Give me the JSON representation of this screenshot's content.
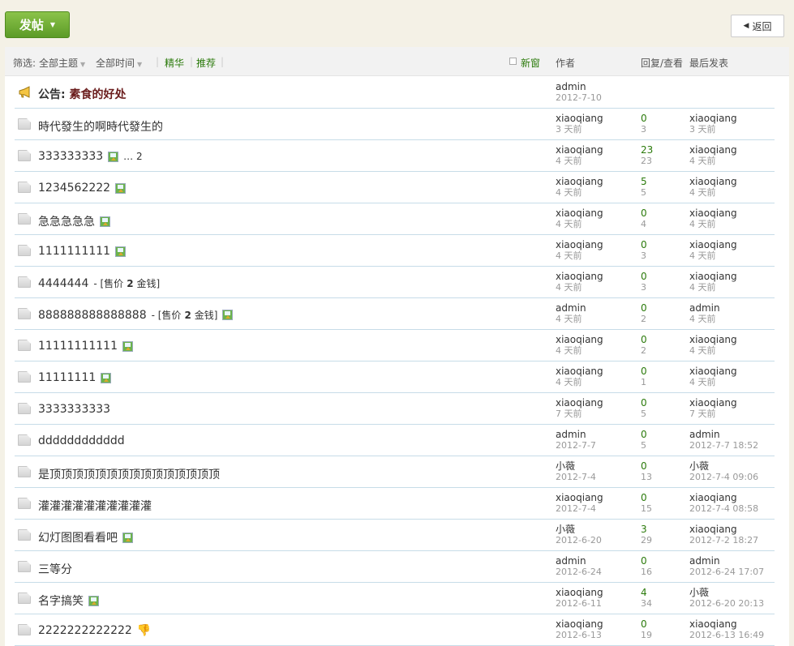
{
  "toolbar": {
    "post_label": "发帖",
    "back_label": "返回"
  },
  "filters": {
    "prefix": "筛选:",
    "all_topics": "全部主题",
    "all_time": "全部时间",
    "digest": "精华",
    "recommended": "推荐",
    "new_window": "新窗"
  },
  "columns": {
    "author": "作者",
    "replies_views": "回复/查看",
    "last_post": "最后发表"
  },
  "announcement": {
    "prefix": "公告: ",
    "title": "素食的好处",
    "author": "admin",
    "date": "2012-7-10"
  },
  "threads": [
    {
      "title": "時代發生的啊時代發生的",
      "extra": "",
      "has_image": false,
      "author": "xiaoqiang",
      "author_time": "3 天前",
      "replies": "0",
      "views": "3",
      "last_user": "xiaoqiang",
      "last_time": "3 天前"
    },
    {
      "title": "333333333",
      "extra": "… 2",
      "has_image": true,
      "author": "xiaoqiang",
      "author_time": "4 天前",
      "replies": "23",
      "views": "23",
      "last_user": "xiaoqiang",
      "last_time": "4 天前"
    },
    {
      "title": "1234562222",
      "extra": "",
      "has_image": true,
      "author": "xiaoqiang",
      "author_time": "4 天前",
      "replies": "5",
      "views": "5",
      "last_user": "xiaoqiang",
      "last_time": "4 天前"
    },
    {
      "title": "急急急急急",
      "extra": "",
      "has_image": true,
      "author": "xiaoqiang",
      "author_time": "4 天前",
      "replies": "0",
      "views": "4",
      "last_user": "xiaoqiang",
      "last_time": "4 天前"
    },
    {
      "title": "1111111111",
      "extra": "",
      "has_image": true,
      "author": "xiaoqiang",
      "author_time": "4 天前",
      "replies": "0",
      "views": "3",
      "last_user": "xiaoqiang",
      "last_time": "4 天前"
    },
    {
      "title": "4444444",
      "price": {
        "pre": " - [售价",
        "num": "2",
        "post": "金钱]"
      },
      "has_image": false,
      "author": "xiaoqiang",
      "author_time": "4 天前",
      "replies": "0",
      "views": "3",
      "last_user": "xiaoqiang",
      "last_time": "4 天前"
    },
    {
      "title": "888888888888888",
      "price": {
        "pre": " - [售价",
        "num": "2",
        "post": "金钱]"
      },
      "has_image": true,
      "author": "admin",
      "author_time": "4 天前",
      "replies": "0",
      "views": "2",
      "last_user": "admin",
      "last_time": "4 天前"
    },
    {
      "title": "11111111111",
      "extra": "",
      "has_image": true,
      "author": "xiaoqiang",
      "author_time": "4 天前",
      "replies": "0",
      "views": "2",
      "last_user": "xiaoqiang",
      "last_time": "4 天前"
    },
    {
      "title": "11111111",
      "extra": "",
      "has_image": true,
      "author": "xiaoqiang",
      "author_time": "4 天前",
      "replies": "0",
      "views": "1",
      "last_user": "xiaoqiang",
      "last_time": "4 天前"
    },
    {
      "title": "3333333333",
      "extra": "",
      "has_image": false,
      "author": "xiaoqiang",
      "author_time": "7 天前",
      "replies": "0",
      "views": "5",
      "last_user": "xiaoqiang",
      "last_time": "7 天前"
    },
    {
      "title": "dddddddddddd",
      "extra": "",
      "has_image": false,
      "author": "admin",
      "author_time": "2012-7-7",
      "replies": "0",
      "views": "5",
      "last_user": "admin",
      "last_time": "2012-7-7 18:52"
    },
    {
      "title": "是顶顶顶顶顶顶顶顶顶顶顶顶顶顶顶",
      "extra": "",
      "has_image": false,
      "author": "小薇",
      "author_time": "2012-7-4",
      "replies": "0",
      "views": "13",
      "last_user": "小薇",
      "last_time": "2012-7-4 09:06"
    },
    {
      "title": "灌灌灌灌灌灌灌灌灌灌",
      "extra": "",
      "has_image": false,
      "author": "xiaoqiang",
      "author_time": "2012-7-4",
      "replies": "0",
      "views": "15",
      "last_user": "xiaoqiang",
      "last_time": "2012-7-4 08:58"
    },
    {
      "title": "幻灯图图看看吧",
      "extra": "",
      "has_image": true,
      "author": "小薇",
      "author_time": "2012-6-20",
      "replies": "3",
      "views": "29",
      "last_user": "xiaoqiang",
      "last_time": "2012-7-2 18:27"
    },
    {
      "title": "三等分",
      "extra": "",
      "has_image": false,
      "author": "admin",
      "author_time": "2012-6-24",
      "replies": "0",
      "views": "16",
      "last_user": "admin",
      "last_time": "2012-6-24 17:07"
    },
    {
      "title": "名字搞笑",
      "extra": "",
      "has_image": true,
      "author": "xiaoqiang",
      "author_time": "2012-6-11",
      "replies": "4",
      "views": "34",
      "last_user": "小薇",
      "last_time": "2012-6-20 20:13"
    },
    {
      "title": "2222222222222",
      "extra": "",
      "has_image": false,
      "thumb": "👎",
      "author": "xiaoqiang",
      "author_time": "2012-6-13",
      "replies": "0",
      "views": "19",
      "last_user": "xiaoqiang",
      "last_time": "2012-6-13 16:49"
    }
  ],
  "colors": {
    "accent_green": "#2b7a0b",
    "row_border": "#c7dce8",
    "announcement_title": "#6a1c1c"
  }
}
